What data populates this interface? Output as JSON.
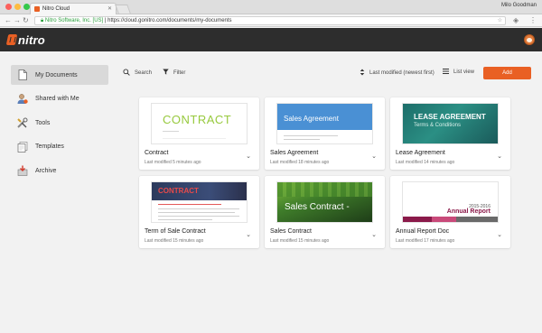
{
  "browser": {
    "tab_title": "Nitro Cloud",
    "user": "Milo Goodman",
    "secure_label": "Nitro Software, Inc. [US]",
    "url": "https://cloud.gonitro.com/documents/my-documents"
  },
  "app": {
    "logo_text": "nitro",
    "accent_color": "#e96024"
  },
  "sidebar": {
    "items": [
      {
        "label": "My Documents",
        "icon": "document-icon",
        "active": true
      },
      {
        "label": "Shared with Me",
        "icon": "shared-user-icon",
        "active": false
      },
      {
        "label": "Tools",
        "icon": "tools-icon",
        "active": false
      },
      {
        "label": "Templates",
        "icon": "templates-icon",
        "active": false
      },
      {
        "label": "Archive",
        "icon": "archive-icon",
        "active": false
      }
    ]
  },
  "toolbar": {
    "search_label": "Search",
    "filter_label": "Filter",
    "sort_label": "Last modified (newest first)",
    "view_label": "List view",
    "add_label": "Add"
  },
  "documents": [
    {
      "title": "Contract",
      "modified": "Last modified 5 minutes ago",
      "thumb_text": "CONTRACT"
    },
    {
      "title": "Sales Agreement",
      "modified": "Last modified 18 minutes ago",
      "thumb_text": "Sales Agreement"
    },
    {
      "title": "Lease Agreement",
      "modified": "Last modified 14 minutes ago",
      "thumb_text": "LEASE AGREEMENT",
      "thumb_subtext": "Terms & Conditions"
    },
    {
      "title": "Term of Sale Contract",
      "modified": "Last modified 15 minutes ago",
      "thumb_text": "CONTRACT"
    },
    {
      "title": "Sales Contract",
      "modified": "Last modified 15 minutes ago",
      "thumb_text": "Sales Contract -"
    },
    {
      "title": "Annual Report Doc",
      "modified": "Last modified 17 minutes ago",
      "thumb_text": "Annual Report",
      "thumb_year": "2015-2016"
    }
  ]
}
